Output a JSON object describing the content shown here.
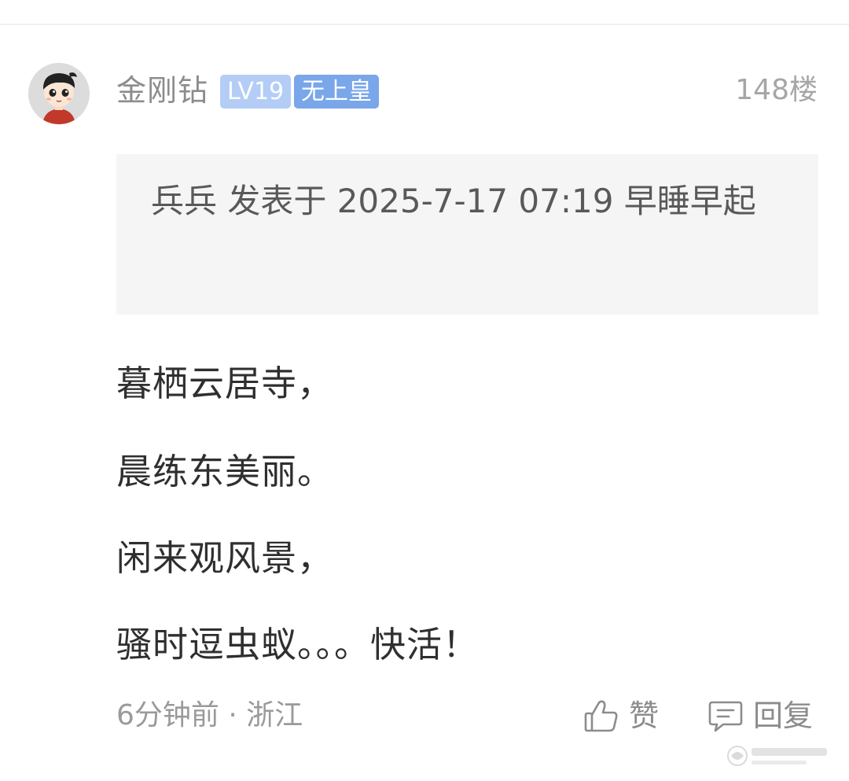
{
  "post": {
    "username": "金刚钻",
    "level_badge": "LV19",
    "title_badge": "无上皇",
    "floor": "148楼",
    "quote": "兵兵 发表于 2025-7-17 07:19 早睡早起",
    "content_lines": [
      "暮栖云居寺，",
      "晨练东美丽。",
      "闲来观风景，",
      "骚时逗虫蚁。。。快活！"
    ],
    "meta": "6分钟前 · 浙江",
    "like_label": "赞",
    "reply_label": "回复"
  },
  "icons": {
    "avatar": "cartoon-boy-avatar",
    "like": "thumbs-up-icon",
    "reply": "comment-bubble-icon",
    "watermark": "site-watermark-logo"
  },
  "colors": {
    "level_badge": "#b4cdf6",
    "title_badge": "#7aa6ea",
    "quote_background": "#f5f5f5",
    "text_primary": "#2f2f2f",
    "text_secondary": "#8c8c8c"
  }
}
